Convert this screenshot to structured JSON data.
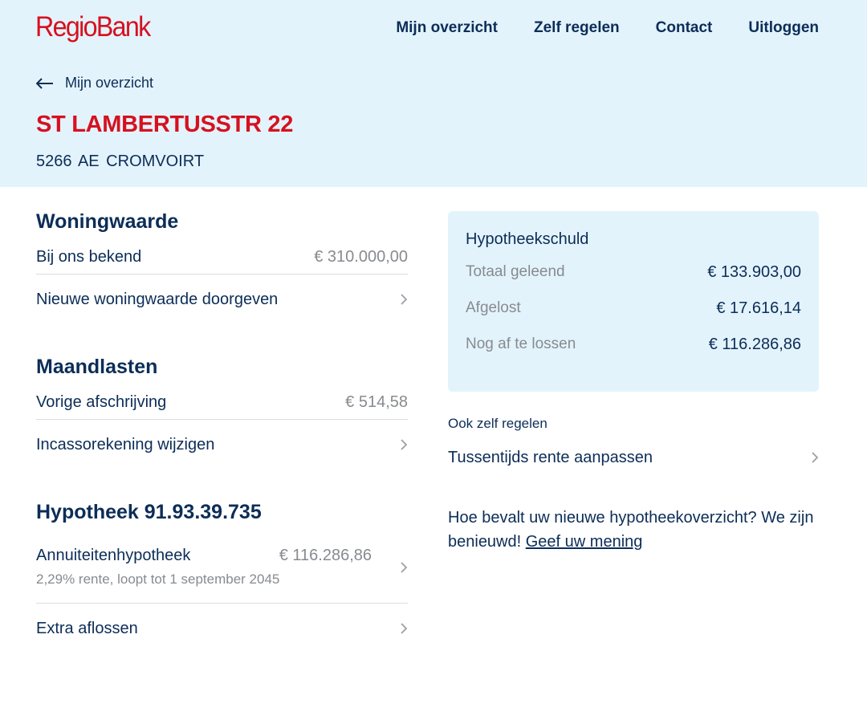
{
  "brand": {
    "name": "RegioBank",
    "accent": "#d6111f",
    "navy": "#0c2d57",
    "band": "#e3f3fc"
  },
  "nav": [
    "Mijn overzicht",
    "Zelf regelen",
    "Contact",
    "Uitloggen"
  ],
  "back": {
    "label": "Mijn overzicht",
    "icon": "arrow-left-icon"
  },
  "address": {
    "street": "ST LAMBERTUSSTR 22",
    "city": "5266 AE  CROMVOIRT"
  },
  "woningwaarde": {
    "title": "Woningwaarde",
    "known_label": "Bij ons bekend",
    "known_value": "€ 310.000,00",
    "link": "Nieuwe woningwaarde doorgeven"
  },
  "maandlasten": {
    "title": "Maandlasten",
    "last_label": "Vorige afschrijving",
    "last_value": "€ 514,58",
    "link": "Incassorekening wijzigen"
  },
  "hypotheek": {
    "title": "Hypotheek 91.93.39.735",
    "type": "Annuiteitenhypotheek",
    "amount": "€ 116.286,86",
    "detail": "2,29% rente, loopt tot 1 september 2045",
    "link": "Extra aflossen"
  },
  "schuld": {
    "title": "Hypotheekschuld",
    "rows": [
      {
        "label": "Totaal geleend",
        "value": "€ 133.903,00"
      },
      {
        "label": "Afgelost",
        "value": "€ 17.616,14"
      },
      {
        "label": "Nog af te lossen",
        "value": "€ 116.286,86"
      }
    ]
  },
  "zelf": {
    "heading": "Ook zelf regelen",
    "link": "Tussentijds rente aanpassen"
  },
  "feedback": {
    "text": "Hoe bevalt uw nieuwe hypotheekoverzicht? We zijn benieuwd! ",
    "link": "Geef uw mening"
  }
}
